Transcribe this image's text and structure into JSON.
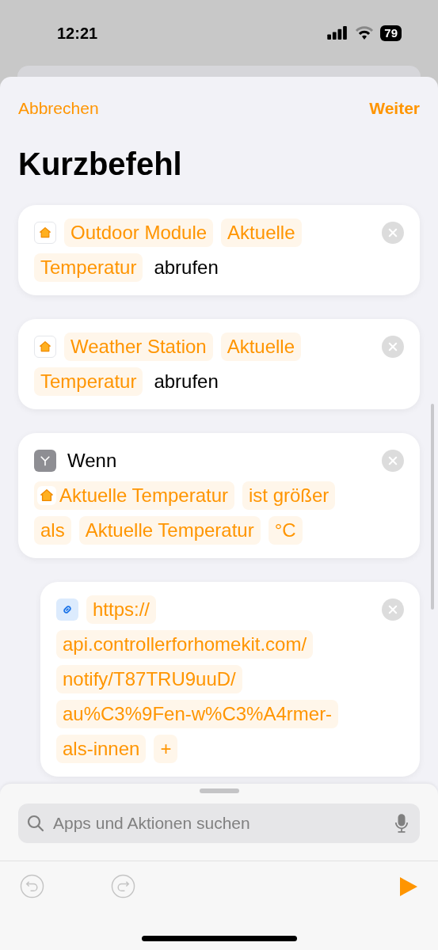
{
  "status_bar": {
    "time": "12:21",
    "battery": "79"
  },
  "nav": {
    "cancel": "Abbrechen",
    "next": "Weiter",
    "title": "Kurzbefehl"
  },
  "actions": [
    {
      "kind": "home",
      "lines": [
        [
          {
            "kind": "token",
            "text": "Outdoor Module"
          },
          {
            "kind": "token",
            "text": "Aktuelle"
          }
        ],
        [
          {
            "kind": "token",
            "text": "Temperatur"
          },
          {
            "kind": "text",
            "text": "abrufen"
          }
        ]
      ]
    },
    {
      "kind": "home",
      "lines": [
        [
          {
            "kind": "token",
            "text": "Weather Station"
          },
          {
            "kind": "token",
            "text": "Aktuelle"
          }
        ],
        [
          {
            "kind": "token",
            "text": "Temperatur"
          },
          {
            "kind": "text",
            "text": "abrufen"
          }
        ]
      ]
    },
    {
      "kind": "branch",
      "lines": [
        [
          {
            "kind": "text",
            "text": "Wenn"
          }
        ],
        [
          {
            "kind": "variable",
            "text": "Aktuelle Temperatur"
          },
          {
            "kind": "token",
            "text": "ist größer"
          }
        ],
        [
          {
            "kind": "token",
            "text": "als"
          },
          {
            "kind": "token",
            "text": "Aktuelle Temperatur"
          },
          {
            "kind": "token",
            "text": "°C"
          }
        ]
      ]
    },
    {
      "kind": "link",
      "lines": [
        [
          {
            "kind": "token",
            "text": "https://"
          }
        ],
        [
          {
            "kind": "token",
            "text": "api.controllerforhomekit.com/"
          }
        ],
        [
          {
            "kind": "token",
            "text": "notify/T87TRU9uuD/"
          }
        ],
        [
          {
            "kind": "token",
            "text": "au%C3%9Fen-w%C3%A4rmer-"
          }
        ],
        [
          {
            "kind": "token",
            "text": "als-innen"
          },
          {
            "kind": "token",
            "text": "+"
          }
        ]
      ]
    }
  ],
  "search": {
    "placeholder": "Apps und Aktionen suchen"
  }
}
